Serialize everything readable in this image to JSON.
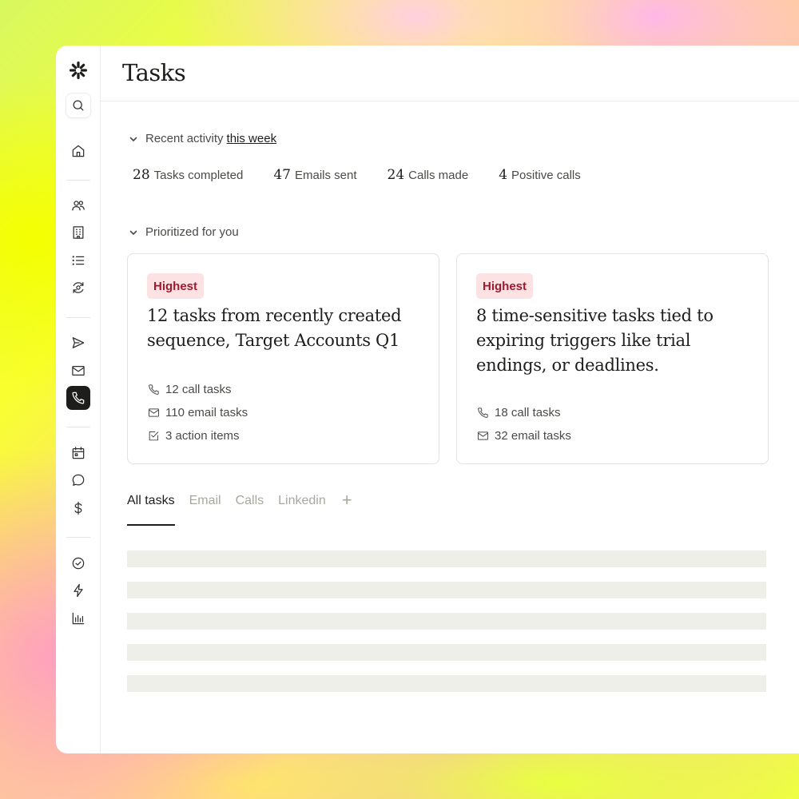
{
  "page": {
    "title": "Tasks"
  },
  "sidebar": {
    "items": [
      {
        "icon": "search-icon"
      },
      {
        "icon": "home-icon"
      },
      {
        "icon": "people-icon"
      },
      {
        "icon": "building-icon"
      },
      {
        "icon": "list-icon"
      },
      {
        "icon": "refresh-eye-icon"
      },
      {
        "icon": "send-icon"
      },
      {
        "icon": "mail-icon"
      },
      {
        "icon": "phone-icon",
        "active": true
      },
      {
        "icon": "calendar-icon"
      },
      {
        "icon": "chat-icon"
      },
      {
        "icon": "dollar-icon"
      },
      {
        "icon": "check-circle-icon"
      },
      {
        "icon": "lightning-icon"
      },
      {
        "icon": "bar-chart-icon"
      }
    ]
  },
  "recent_activity": {
    "label": "Recent activity",
    "period_link": "this week",
    "stats": [
      {
        "value": "28",
        "label": "Tasks completed"
      },
      {
        "value": "47",
        "label": "Emails sent"
      },
      {
        "value": "24",
        "label": "Calls made"
      },
      {
        "value": "4",
        "label": "Positive calls"
      }
    ]
  },
  "prioritized": {
    "label": "Prioritized for you",
    "cards": [
      {
        "badge": "Highest",
        "title": "12 tasks from recently created sequence, Target Accounts Q1",
        "items": [
          {
            "icon": "phone-icon",
            "text": "12 call tasks"
          },
          {
            "icon": "mail-icon",
            "text": "110 email tasks"
          },
          {
            "icon": "checkbox-icon",
            "text": "3 action items"
          }
        ]
      },
      {
        "badge": "Highest",
        "title": "8 time-sensitive tasks tied to expiring triggers like trial endings, or deadlines.",
        "items": [
          {
            "icon": "phone-icon",
            "text": "18 call tasks"
          },
          {
            "icon": "mail-icon",
            "text": "32 email tasks"
          }
        ]
      }
    ]
  },
  "tabs": [
    "All tasks",
    "Email",
    "Calls",
    "Linkedin"
  ],
  "tabs_add": "+",
  "colors": {
    "accent": "#1d1d1b",
    "badge_bg": "#fde2e4",
    "badge_text": "#9b1b30",
    "placeholder": "#efefea"
  }
}
